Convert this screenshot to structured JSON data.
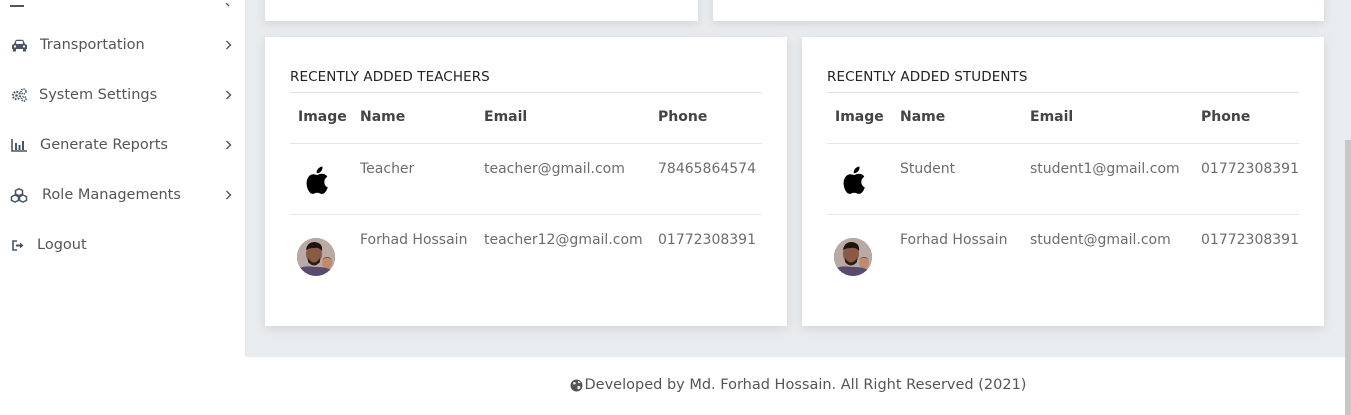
{
  "sidebar": {
    "items": [
      {
        "label": "Transportation",
        "icon": "car-icon"
      },
      {
        "label": "System Settings",
        "icon": "gears-icon"
      },
      {
        "label": "Generate Reports",
        "icon": "bar-chart-icon"
      },
      {
        "label": "Role Managements",
        "icon": "cubes-icon"
      },
      {
        "label": "Logout",
        "icon": "sign-out-icon"
      }
    ]
  },
  "teachers": {
    "title": "RECENTLY ADDED TEACHERS",
    "headers": [
      "Image",
      "Name",
      "Email",
      "Phone"
    ],
    "rows": [
      {
        "image": "apple-logo",
        "name": "Teacher",
        "email": "teacher@gmail.com",
        "phone": "78465864574"
      },
      {
        "image": "profile-photo",
        "name": "Forhad Hossain",
        "email": "teacher12@gmail.com",
        "phone": "01772308391"
      }
    ]
  },
  "students": {
    "title": "RECENTLY ADDED STUDENTS",
    "headers": [
      "Image",
      "Name",
      "Email",
      "Phone"
    ],
    "rows": [
      {
        "image": "apple-logo",
        "name": "Student",
        "email": "student1@gmail.com",
        "phone": "01772308391"
      },
      {
        "image": "profile-photo",
        "name": "Forhad Hossain",
        "email": "student@gmail.com",
        "phone": "01772308391"
      }
    ]
  },
  "footer": {
    "text": "Developed by Md. Forhad Hossain. All Right Reserved (2021)",
    "icon": "globe-icon"
  },
  "colors": {
    "background": "#e9ecef",
    "card": "#ffffff",
    "text": "#6c6c6c"
  }
}
